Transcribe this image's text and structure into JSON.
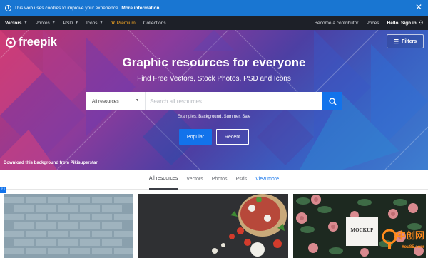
{
  "cookie_bar": {
    "text": "This web uses cookies to improve your experience.",
    "more_info": "More information"
  },
  "nav": {
    "items": [
      {
        "label": "Vectors",
        "dropdown": true,
        "active": true
      },
      {
        "label": "Photos",
        "dropdown": true
      },
      {
        "label": "PSD",
        "dropdown": true
      },
      {
        "label": "Icons",
        "dropdown": true
      }
    ],
    "premium": "Premium",
    "collections": "Collections",
    "contributor": "Become a contributor",
    "prices": "Prices",
    "signin": "Hello, Sign in"
  },
  "hero": {
    "logo": "freepik",
    "filters": "Filters",
    "title": "Graphic resources for everyone",
    "subtitle": "Find Free Vectors, Stock Photos, PSD and Icons",
    "search_select": "All resources",
    "search_placeholder": "Search all resources",
    "examples_label": "Examples:",
    "examples": [
      "Background,",
      "Summer,",
      "Sale"
    ],
    "btn_popular": "Popular",
    "btn_recent": "Recent",
    "bg_credit": "Download this background from Pikisuperstar"
  },
  "tabs": {
    "all": "All resources",
    "vectors": "Vectors",
    "photos": "Photos",
    "psds": "Psds",
    "view_more": "View more"
  },
  "gallery": {
    "mockup_text": "MOCKUP"
  },
  "watermark": {
    "text": "中创网",
    "sub": "You85.com"
  },
  "colors": {
    "cookie_bar": "#1976d2",
    "nav_bg": "#1d2028",
    "accent": "#1273eb",
    "premium": "#f5a623"
  }
}
